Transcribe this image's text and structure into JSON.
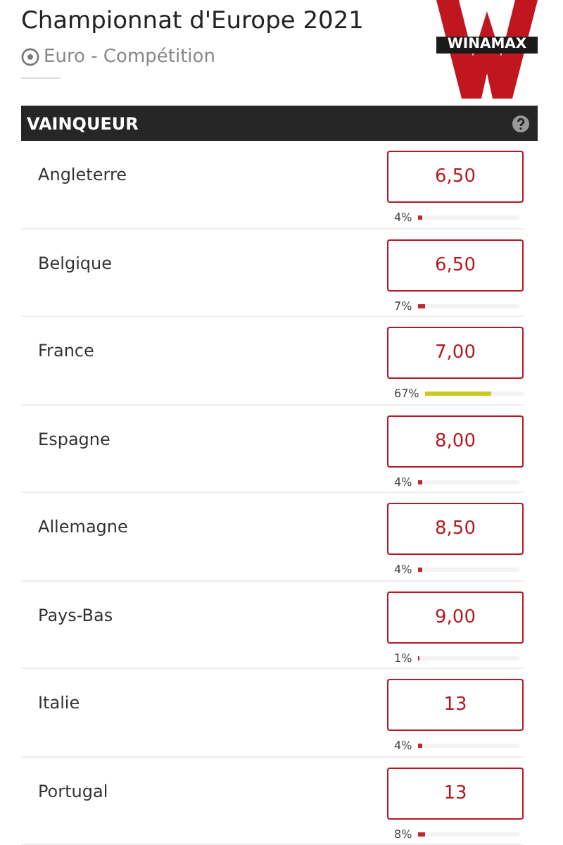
{
  "title": "Championnat d'Europe 2021",
  "subtitle": "Euro - Compétition",
  "logo": "WINAMAX",
  "section": {
    "title": "VAINQUEUR"
  },
  "rows": [
    {
      "name": "Angleterre",
      "odds": "6,50",
      "share": "4%",
      "level": 0.04,
      "color": "#c0262d"
    },
    {
      "name": "Belgique",
      "odds": "6,50",
      "share": "7%",
      "level": 0.07,
      "color": "#c0262d"
    },
    {
      "name": "France",
      "odds": "7,00",
      "share": "67%",
      "level": 0.67,
      "color": "#c9c924"
    },
    {
      "name": "Espagne",
      "odds": "8,00",
      "share": "4%",
      "level": 0.04,
      "color": "#c0262d"
    },
    {
      "name": "Allemagne",
      "odds": "8,50",
      "share": "4%",
      "level": 0.04,
      "color": "#c0262d"
    },
    {
      "name": "Pays-Bas",
      "odds": "9,00",
      "share": "1%",
      "level": 0.01,
      "color": "#c0262d"
    },
    {
      "name": "Italie",
      "odds": "13",
      "share": "4%",
      "level": 0.04,
      "color": "#c0262d"
    },
    {
      "name": "Portugal",
      "odds": "13",
      "share": "8%",
      "level": 0.08,
      "color": "#c0262d"
    }
  ]
}
